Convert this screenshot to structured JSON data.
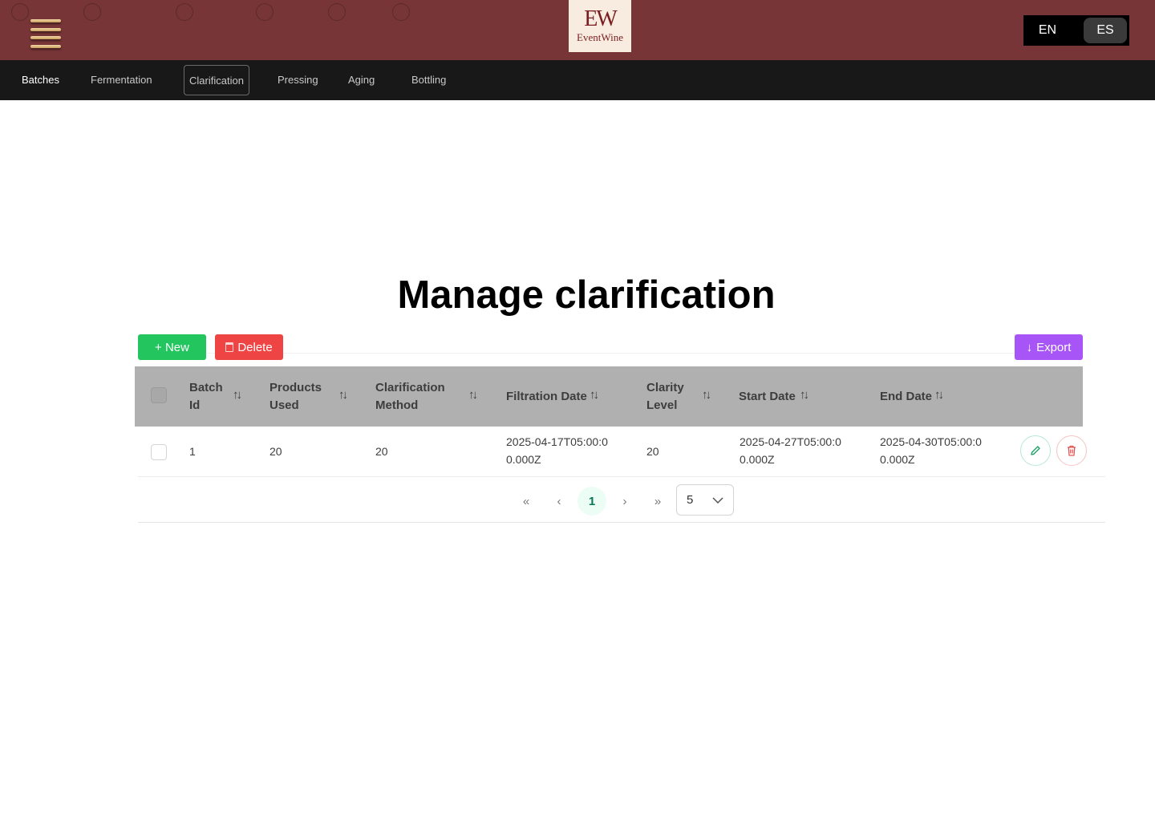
{
  "header": {
    "logo_mark": "EW",
    "logo_text": "EventWine",
    "languages": [
      "EN",
      "ES"
    ],
    "active_language": "ES"
  },
  "nav": {
    "items": [
      "Batches",
      "Fermentation",
      "Clarification",
      "Pressing",
      "Aging",
      "Bottling"
    ],
    "active": "Clarification"
  },
  "page": {
    "title": "Manage clarification"
  },
  "toolbar": {
    "new_label": "+ New",
    "delete_label": "Delete",
    "export_label": "Export"
  },
  "table": {
    "columns": [
      "Batch Id",
      "Products Used",
      "Clarification Method",
      "Filtration Date",
      "Clarity Level",
      "Start Date",
      "End Date"
    ],
    "rows": [
      {
        "batch_id": "1",
        "products_used": "20",
        "clarification_method": "20",
        "filtration_date": "2025-04-17T05:00:00.000Z",
        "clarity_level": "20",
        "start_date": "2025-04-27T05:00:00.000Z",
        "end_date": "2025-04-30T05:00:00.000Z"
      }
    ]
  },
  "pagination": {
    "first": "«",
    "prev": "‹",
    "current_page": "1",
    "next": "›",
    "last": "»",
    "rows_per_page": "5"
  },
  "colors": {
    "header_bg": "#773537",
    "nav_bg": "#181818",
    "new_button": "#22c55e",
    "delete_button": "#ef4444",
    "export_button": "#a855f7",
    "table_header_bg": "#b0b0b0"
  }
}
